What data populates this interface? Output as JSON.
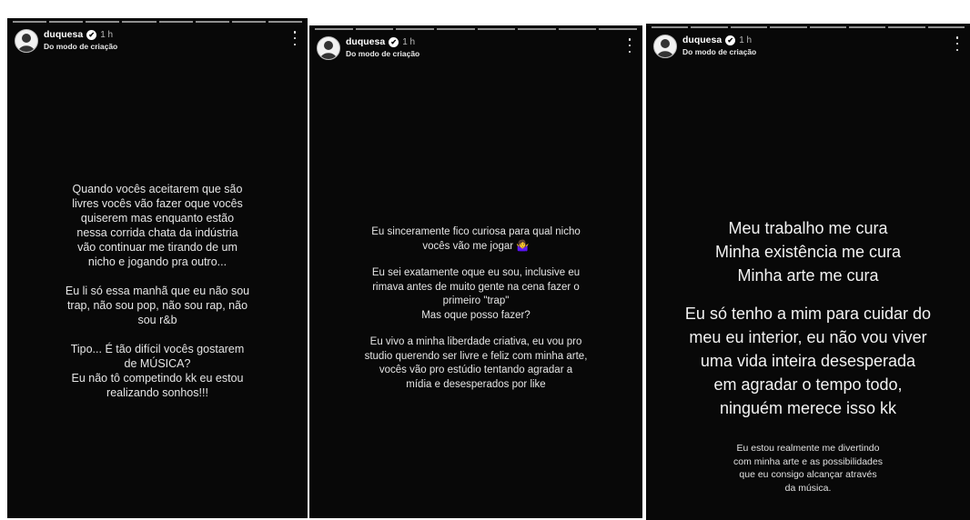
{
  "stories": [
    {
      "username": "duquesa",
      "time": "1 h",
      "subtitle": "Do modo de criação",
      "paragraphs": [
        "Quando vocês aceitarem que são\nlivres vocês vão fazer oque vocês\nquiserem mas enquanto estão\nnessa corrida chata da indústria\nvão continuar me tirando de um\nnicho e jogando pra outro...",
        "Eu li só essa manhã que eu não sou\ntrap, não sou pop, não sou rap, não\nsou r&b",
        "Tipo... É tão difícil vocês gostarem\nde MÚSICA?\nEu não tô competindo kk eu estou\nrealizando sonhos!!!"
      ]
    },
    {
      "username": "duquesa",
      "time": "1 h",
      "subtitle": "Do modo de criação",
      "paragraphs": [
        "Eu sinceramente fico curiosa para qual nicho\nvocês vão me jogar 🤷‍♀️",
        "Eu sei exatamente oque eu sou, inclusive eu\nrimava antes de muito gente na cena fazer o\nprimeiro \"trap\"\nMas oque posso fazer?",
        "Eu vivo a minha liberdade criativa, eu vou pro\nstudio querendo ser livre e feliz com minha arte,\nvocês vão pro estúdio tentando agradar a\nmídia e desesperados por like"
      ]
    },
    {
      "username": "duquesa",
      "time": "1 h",
      "subtitle": "Do modo de criação",
      "paragraphs": [
        "Meu trabalho me cura\nMinha existência me cura\nMinha arte me cura",
        "Eu só tenho a mim para cuidar do\nmeu eu interior, eu não vou viver\numa vida inteira desesperada\nem agradar o tempo todo,\nninguém merece isso kk",
        "Eu estou realmente me divertindo\ncom minha arte e as possibilidades\nque eu consigo alcançar através\nda música."
      ]
    }
  ]
}
